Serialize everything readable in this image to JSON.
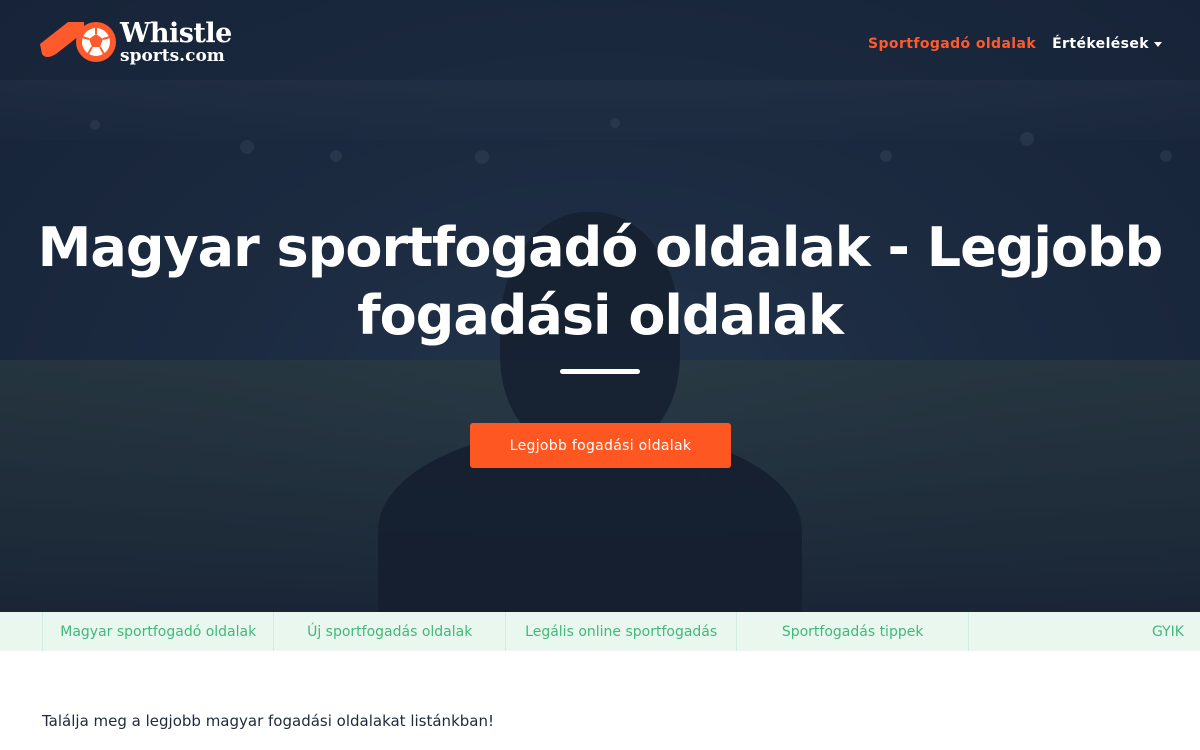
{
  "brand": {
    "line1": "Whistle",
    "line2": "sports.com",
    "accent": "#ff5a2c"
  },
  "nav": {
    "items": [
      {
        "label": "Sportfogadó oldalak",
        "active": true
      },
      {
        "label": "Értékelések",
        "dropdown": true
      }
    ]
  },
  "hero": {
    "title": "Magyar sportfogadó oldalak - Legjobb fogadási oldalak",
    "cta_label": "Legjobb fogadási oldalak",
    "cta_color": "#ff5722"
  },
  "subnav": {
    "items": [
      {
        "label": "Magyar sportfogadó oldalak"
      },
      {
        "label": "Új sportfogadás oldalak"
      },
      {
        "label": "Legális online sportfogadás"
      },
      {
        "label": "Sportfogadás tippek"
      },
      {
        "label": "GYIK"
      }
    ],
    "text_color": "#3fb97a"
  },
  "intro_text": "Találja meg a legjobb magyar fogadási oldalakat listánkban!"
}
